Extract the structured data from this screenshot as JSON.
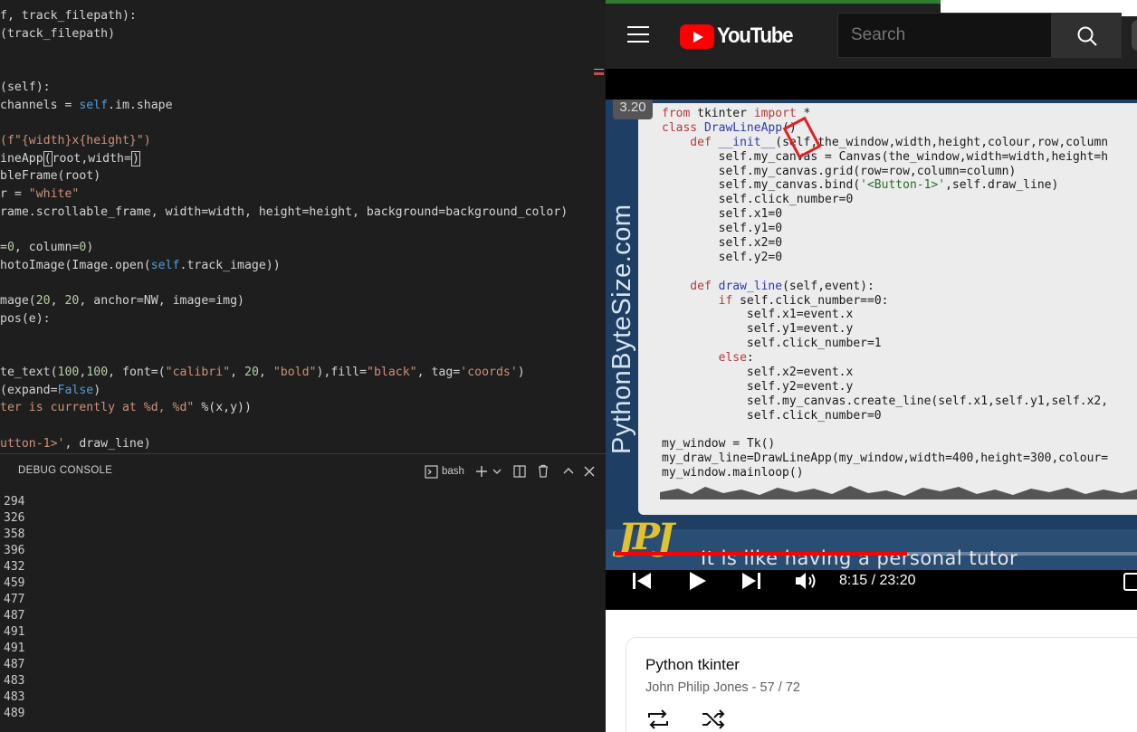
{
  "editor": {
    "lines": [
      {
        "segments": [
          {
            "t": "f, track_filepath):",
            "c": "def"
          }
        ]
      },
      {
        "segments": [
          {
            "t": "(track_filepath)",
            "c": "def"
          }
        ]
      },
      {
        "segments": []
      },
      {
        "segments": []
      },
      {
        "segments": [
          {
            "t": "(self):",
            "c": "def"
          }
        ]
      },
      {
        "segments": [
          {
            "t": "channels = ",
            "c": "def"
          },
          {
            "t": "self",
            "c": "self"
          },
          {
            "t": ".im.shape",
            "c": "def"
          }
        ]
      },
      {
        "segments": []
      },
      {
        "segments": [
          {
            "t": "(f\"{width}x{height}\")",
            "c": "str"
          }
        ]
      },
      {
        "segments": [
          {
            "t": "ineApp",
            "c": "def"
          },
          {
            "t": "(",
            "c": "cursor"
          },
          {
            "t": "root,width=",
            "c": "def"
          },
          {
            "t": ")",
            "c": "cursor"
          }
        ]
      },
      {
        "segments": [
          {
            "t": "bleFrame(root)",
            "c": "def"
          }
        ]
      },
      {
        "segments": [
          {
            "t": "r = ",
            "c": "def"
          },
          {
            "t": "\"white\"",
            "c": "str"
          }
        ]
      },
      {
        "segments": [
          {
            "t": "rame.scrollable_frame, width=width, height=height, background=background_color)",
            "c": "def"
          }
        ]
      },
      {
        "segments": []
      },
      {
        "segments": [
          {
            "t": "=",
            "c": "def"
          },
          {
            "t": "0",
            "c": "num"
          },
          {
            "t": ", column=",
            "c": "def"
          },
          {
            "t": "0",
            "c": "num"
          },
          {
            "t": ")",
            "c": "def"
          }
        ]
      },
      {
        "segments": [
          {
            "t": "hotoImage(Image.open(",
            "c": "def"
          },
          {
            "t": "self",
            "c": "self"
          },
          {
            "t": ".track_image))",
            "c": "def"
          }
        ]
      },
      {
        "segments": []
      },
      {
        "segments": [
          {
            "t": "mage(",
            "c": "def"
          },
          {
            "t": "20",
            "c": "num"
          },
          {
            "t": ", ",
            "c": "def"
          },
          {
            "t": "20",
            "c": "num"
          },
          {
            "t": ", anchor=NW, image=img)",
            "c": "def"
          }
        ]
      },
      {
        "segments": [
          {
            "t": "pos(e):",
            "c": "def"
          }
        ]
      },
      {
        "segments": []
      },
      {
        "segments": []
      },
      {
        "segments": [
          {
            "t": "te_text(",
            "c": "def"
          },
          {
            "t": "100",
            "c": "num"
          },
          {
            "t": ",",
            "c": "def"
          },
          {
            "t": "100",
            "c": "num"
          },
          {
            "t": ", font=(",
            "c": "def"
          },
          {
            "t": "\"calibri\"",
            "c": "str"
          },
          {
            "t": ", ",
            "c": "def"
          },
          {
            "t": "20",
            "c": "num"
          },
          {
            "t": ", ",
            "c": "def"
          },
          {
            "t": "\"bold\"",
            "c": "str"
          },
          {
            "t": "),fill=",
            "c": "def"
          },
          {
            "t": "\"black\"",
            "c": "str"
          },
          {
            "t": ", tag=",
            "c": "def"
          },
          {
            "t": "'coords'",
            "c": "str"
          },
          {
            "t": ")",
            "c": "def"
          }
        ]
      },
      {
        "segments": [
          {
            "t": "(expand=",
            "c": "def"
          },
          {
            "t": "False",
            "c": "self"
          },
          {
            "t": ")",
            "c": "def"
          }
        ]
      },
      {
        "segments": [
          {
            "t": "ter is currently at %d, %d\"",
            "c": "str"
          },
          {
            "t": " %(x,y))",
            "c": "def"
          }
        ]
      },
      {
        "segments": []
      },
      {
        "segments": [
          {
            "t": "utton-1>'",
            "c": "str"
          },
          {
            "t": ", draw_line)",
            "c": "def"
          }
        ]
      }
    ]
  },
  "panel": {
    "tab_label": "DEBUG CONSOLE",
    "terminal_name": "bash",
    "output": [
      "294",
      "326",
      "358",
      "396",
      "432",
      "459",
      "477",
      "487",
      "491",
      "491",
      "487",
      "483",
      "483",
      "489"
    ]
  },
  "youtube": {
    "logo_text": "YouTube",
    "search_placeholder": "Search",
    "video": {
      "timestamp_badge": "3.20",
      "brand_text": "PythonByteSize.com",
      "code_lines": [
        [
          {
            "t": "from",
            "c": "kw"
          },
          {
            "t": " tkinter ",
            "c": "n"
          },
          {
            "t": "import",
            "c": "kw"
          },
          {
            "t": " *",
            "c": "n"
          }
        ],
        [
          {
            "t": "class",
            "c": "kw"
          },
          {
            "t": " DrawLineApp",
            "c": "cls"
          },
          {
            "t": "()",
            "c": "n"
          }
        ],
        [
          {
            "t": "    def",
            "c": "kw"
          },
          {
            "t": " __init__",
            "c": "cls"
          },
          {
            "t": "(self,the_window,width,height,colour,row,column",
            "c": "n"
          }
        ],
        [
          {
            "t": "        self.my_canvas = Canvas(the_window,width=width,height=h",
            "c": "n"
          }
        ],
        [
          {
            "t": "        self.my_canvas.grid(row=row,column=column)",
            "c": "n"
          }
        ],
        [
          {
            "t": "        self.my_canvas.bind(",
            "c": "n"
          },
          {
            "t": "'<Button-1>'",
            "c": "str"
          },
          {
            "t": ",self.draw_line)",
            "c": "n"
          }
        ],
        [
          {
            "t": "        self.click_number=0",
            "c": "n"
          }
        ],
        [
          {
            "t": "        self.x1=0",
            "c": "n"
          }
        ],
        [
          {
            "t": "        self.y1=0",
            "c": "n"
          }
        ],
        [
          {
            "t": "        self.x2=0",
            "c": "n"
          }
        ],
        [
          {
            "t": "        self.y2=0",
            "c": "n"
          }
        ],
        [
          {
            "t": "",
            "c": "n"
          }
        ],
        [
          {
            "t": "    def",
            "c": "kw"
          },
          {
            "t": " draw_line",
            "c": "cls"
          },
          {
            "t": "(self,event):",
            "c": "n"
          }
        ],
        [
          {
            "t": "        if",
            "c": "kw"
          },
          {
            "t": " self.click_number==0:",
            "c": "n"
          }
        ],
        [
          {
            "t": "            self.x1=event.x",
            "c": "n"
          }
        ],
        [
          {
            "t": "            self.y1=event.y",
            "c": "n"
          }
        ],
        [
          {
            "t": "            self.click_number=1",
            "c": "n"
          }
        ],
        [
          {
            "t": "        else",
            "c": "kw"
          },
          {
            "t": ":",
            "c": "n"
          }
        ],
        [
          {
            "t": "            self.x2=event.x",
            "c": "n"
          }
        ],
        [
          {
            "t": "            self.y2=event.y",
            "c": "n"
          }
        ],
        [
          {
            "t": "            self.my_canvas.create_line(self.x1,self.y1,self.x2,",
            "c": "n"
          }
        ],
        [
          {
            "t": "            self.click_number=0",
            "c": "n"
          }
        ],
        [
          {
            "t": "",
            "c": "n"
          }
        ],
        [
          {
            "t": "my_window = Tk()",
            "c": "n"
          }
        ],
        [
          {
            "t": "my_draw_line=DrawLineApp(my_window,width=400,height=300,colour=",
            "c": "n"
          }
        ],
        [
          {
            "t": "my_window.mainloop()",
            "c": "n"
          }
        ]
      ],
      "subtitle": "It is like having a personal tutor",
      "logo_text": "JPJ",
      "time": "8:15 / 23:20",
      "progress_fraction": 0.56
    },
    "playlist": {
      "title": "Python tkinter",
      "meta": "John Philip Jones - 57 / 72"
    }
  }
}
